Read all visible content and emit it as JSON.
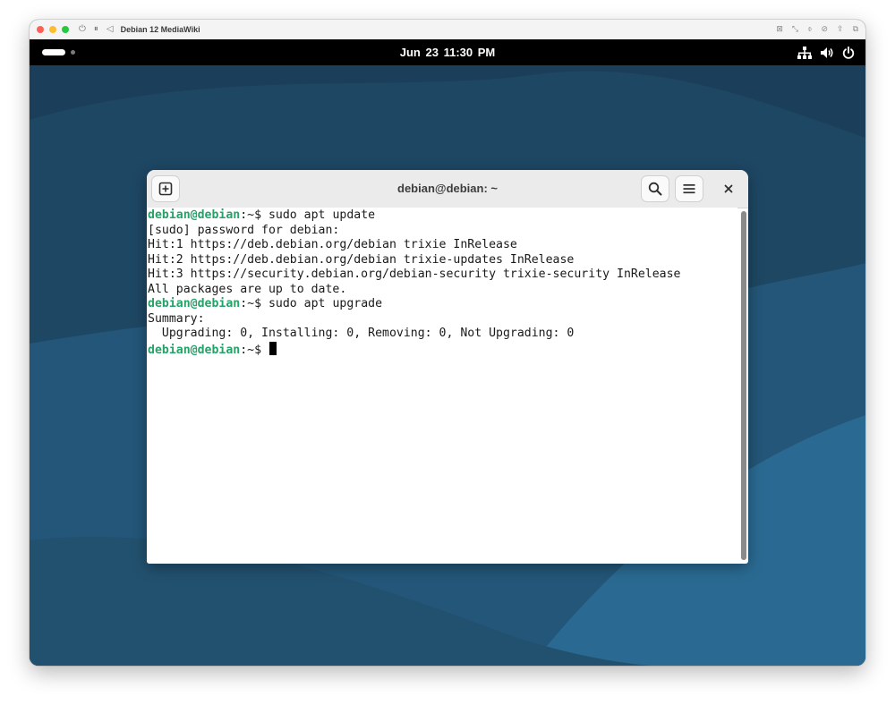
{
  "vm": {
    "title": "Debian 12 MediaWiki",
    "controls": {
      "power": "⏻",
      "pause": "⏸",
      "back": "◁"
    },
    "right_icons": [
      "⊠",
      "⤡",
      "⌽",
      "⊘",
      "⇪",
      "⧉"
    ]
  },
  "topbar": {
    "date": "Jun 23",
    "time": "11:30 PM"
  },
  "terminal": {
    "title": "debian@debian: ~",
    "prompt_user_host": "debian@debian",
    "prompt_suffix": ":~$ ",
    "lines": [
      {
        "type": "prompt",
        "cmd": "sudo apt update"
      },
      {
        "type": "text",
        "text": "[sudo] password for debian:"
      },
      {
        "type": "text",
        "text": "Hit:1 https://deb.debian.org/debian trixie InRelease"
      },
      {
        "type": "text",
        "text": "Hit:2 https://deb.debian.org/debian trixie-updates InRelease"
      },
      {
        "type": "text",
        "text": "Hit:3 https://security.debian.org/debian-security trixie-security InRelease"
      },
      {
        "type": "text",
        "text": "All packages are up to date."
      },
      {
        "type": "prompt",
        "cmd": "sudo apt upgrade"
      },
      {
        "type": "text",
        "text": "Summary:"
      },
      {
        "type": "text",
        "text": "  Upgrading: 0, Installing: 0, Removing: 0, Not Upgrading: 0"
      },
      {
        "type": "prompt",
        "cmd": "",
        "cursor": true
      }
    ]
  },
  "colors": {
    "prompt": "#26a269",
    "wallpaper_dark": "#1e4764",
    "wallpaper_light": "#2a6a92"
  },
  "icons": {
    "new_tab": "new-tab-icon",
    "search": "search-icon",
    "menu": "hamburger-menu-icon",
    "close": "close-icon",
    "network": "network-wired-icon",
    "volume": "volume-icon",
    "power": "power-icon"
  }
}
